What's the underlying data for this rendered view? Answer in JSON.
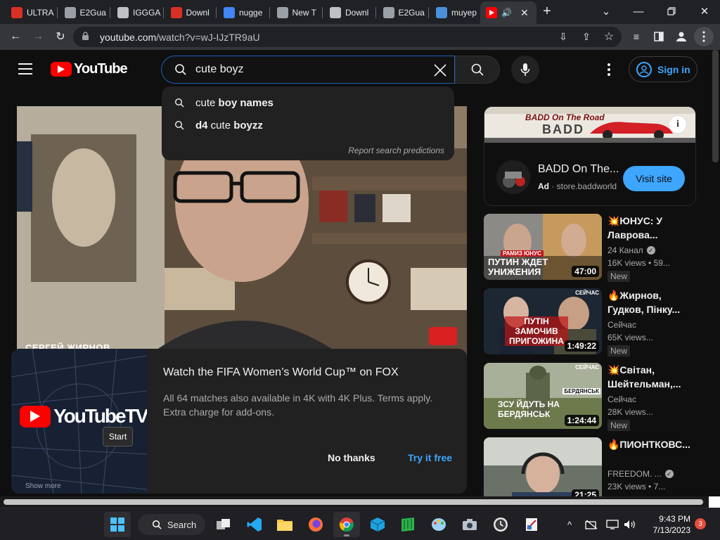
{
  "browser": {
    "tabs": [
      {
        "label": "ULTRA",
        "icon": "red-tab-icon",
        "color": "#d93025"
      },
      {
        "label": "E2Gua",
        "icon": "globe-tab-icon",
        "color": "#9aa0a6"
      },
      {
        "label": "IGGGA",
        "icon": "page-tab-icon",
        "color": "#bdc1c6"
      },
      {
        "label": "Downl",
        "icon": "m-tab-icon",
        "color": "#d93025"
      },
      {
        "label": "nugge",
        "icon": "google-tab-icon",
        "color": "#4285f4"
      },
      {
        "label": "New T",
        "icon": "chrome-tab-icon",
        "color": "#9aa0a6"
      },
      {
        "label": "Downl",
        "icon": "doc-tab-icon",
        "color": "#bdc1c6"
      },
      {
        "label": "E2Gua",
        "icon": "globe-tab-icon",
        "color": "#9aa0a6"
      },
      {
        "label": "muyep",
        "icon": "fish-tab-icon",
        "color": "#4a90d9"
      }
    ],
    "url_domain": "youtube.com",
    "url_path": "/watch?v=wJ-IJzTR9aU"
  },
  "youtube": {
    "logo_text": "YouTube",
    "search_value": "cute boyz",
    "signin_label": "Sign in",
    "suggestions": [
      {
        "plain": "cute ",
        "bold": "boy names",
        "prefix_bold": ""
      },
      {
        "plain": " cute ",
        "bold": "boyzz",
        "prefix_bold": "d4"
      }
    ],
    "report_label": "Report search predictions",
    "video_overlay": "СЕРГЕЙ ЖИРНОВ",
    "promo": {
      "logo_text": "YouTubeTV",
      "title": "Watch the FIFA Women’s World Cup™ on FOX",
      "body": "All 64 matches also available in 4K with 4K Plus. Terms apply. Extra charge for add-ons.",
      "dismiss": "No thanks",
      "cta": "Try it free",
      "bottom_text": "Show more"
    },
    "ad": {
      "banner_text": "BADD On The Road",
      "banner_logo": "BADD",
      "title": "BADD On The...",
      "ad_label": "Ad",
      "domain": "store.baddworld",
      "cta": "Visit site"
    },
    "recommendations": [
      {
        "title": "💥ЮНУС: У Лаврова...",
        "channel": "24 Канал",
        "verified": true,
        "views": "16K views",
        "age": "59...",
        "badge": "New",
        "duration": "47:00",
        "thumb_text": "ПУТИН ЖДЕТ УНИЖЕНИЯ",
        "thumb_tag": "РАМИЗ ЮНУС"
      },
      {
        "title": "🔥Жирнов, Гудков, Пінку...",
        "channel": "Сейчас",
        "verified": false,
        "views": "65K views...",
        "age": "",
        "badge": "New",
        "duration": "1:49:22",
        "thumb_text": "ПУТІН ЗАМОЧИВ ПРИГОЖИНА",
        "thumb_tag": "СЕЙЧАС"
      },
      {
        "title": "💥Світан, Шейтельман,...",
        "channel": "Сейчас",
        "verified": false,
        "views": "28K views...",
        "age": "",
        "badge": "New",
        "duration": "1:24:44",
        "thumb_text": "ЗСУ ЙДУТЬ НА БЕРДЯНСЬК",
        "thumb_tag": "СЕЙЧАС",
        "thumb_tag2": "БЕРДЯНСЬК"
      },
      {
        "title": "🔥ПИОНТКОВС...",
        "channel": "FREEDOM. ...",
        "verified": true,
        "views": "23K views",
        "age": "7...",
        "badge": "",
        "duration": "21:25",
        "thumb_text": "",
        "thumb_tag": ""
      }
    ]
  },
  "overlay_tooltip": "Start",
  "taskbar": {
    "search_label": "Search",
    "time": "9:43 PM",
    "date": "7/13/2023",
    "notifications": "3"
  }
}
